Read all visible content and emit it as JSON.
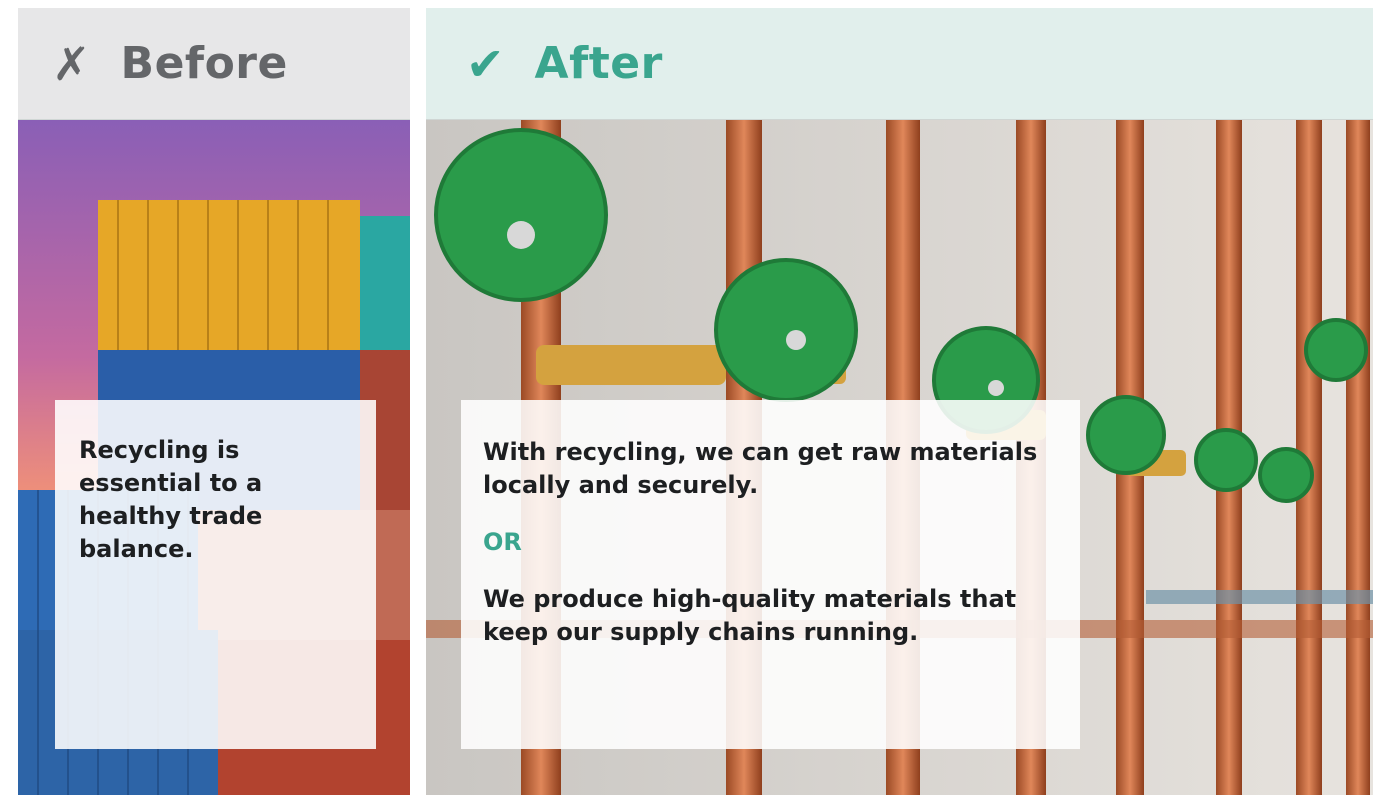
{
  "before": {
    "mark": "✗",
    "title": "Before",
    "card_text": "Recycling is essential to a healthy trade balance.",
    "photo_subject": "stacked-shipping-containers"
  },
  "after": {
    "mark": "✔",
    "title": "After",
    "statement_1": "With recycling, we can get raw materials locally and securely.",
    "or_label": "OR",
    "statement_2": "We produce high-quality materials that keep our supply chains running.",
    "photo_subject": "copper-pipes-green-valves"
  },
  "colors": {
    "accent_green": "#3aa58e",
    "before_header_bg": "#e7e7e8",
    "after_header_bg": "#e1efec",
    "before_text": "#646669"
  }
}
